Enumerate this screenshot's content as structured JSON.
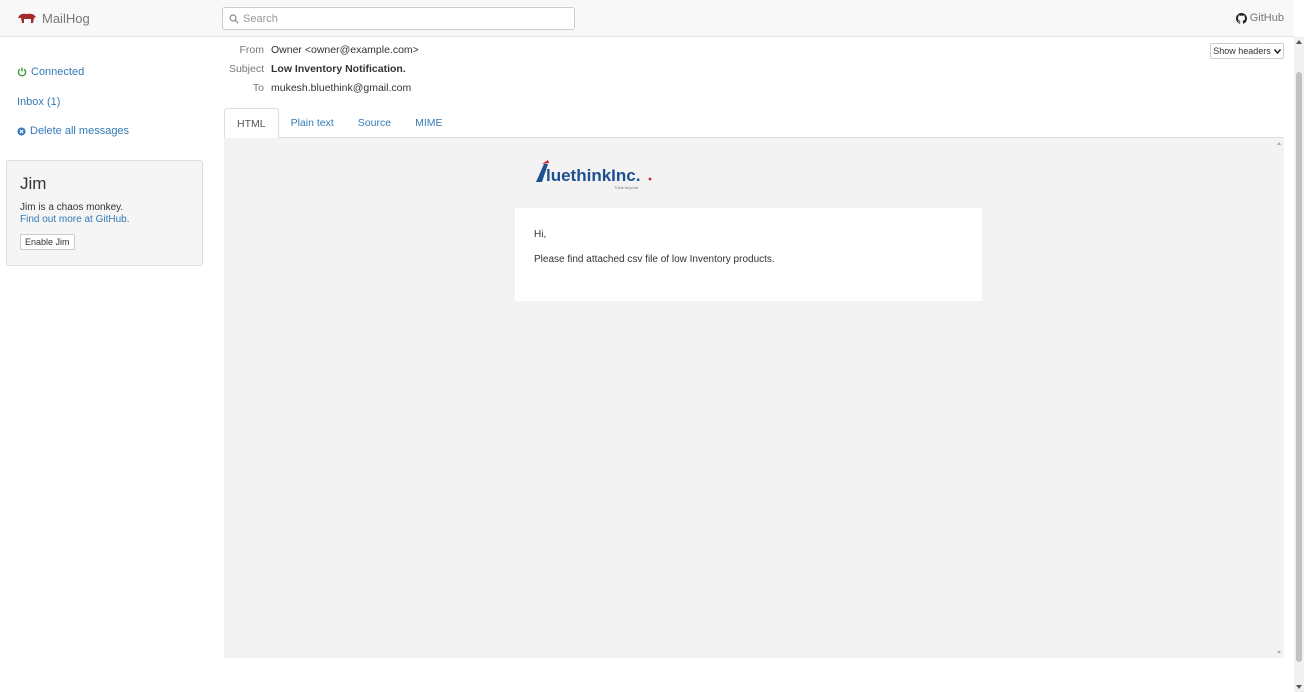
{
  "app": {
    "name": "MailHog",
    "github_label": "GitHub"
  },
  "search": {
    "placeholder": "Search"
  },
  "sidebar": {
    "connected": "Connected",
    "inbox": "Inbox (1)",
    "delete_all": "Delete all messages",
    "jim": {
      "title": "Jim",
      "description": "Jim is a chaos monkey.",
      "link": "Find out more at GitHub.",
      "button": "Enable Jim"
    }
  },
  "message": {
    "from_label": "From",
    "from": "Owner <owner@example.com>",
    "subject_label": "Subject",
    "subject": "Low Inventory Notification.",
    "to_label": "To",
    "to": "mukesh.bluethink@gmail.com",
    "show_headers": "Show headers",
    "tabs": [
      {
        "label": "HTML",
        "active": true
      },
      {
        "label": "Plain text",
        "active": false
      },
      {
        "label": "Source",
        "active": false
      },
      {
        "label": "MIME",
        "active": false
      }
    ],
    "body": {
      "logo": {
        "text": "luethinkInc.",
        "tagline": "Think beyond"
      },
      "greeting": "Hi,",
      "text": "Please find attached csv file of low Inventory products."
    }
  },
  "colors": {
    "link": "#337ab7",
    "connected": "#3c9a3c",
    "logo_blue": "#1d4f91",
    "logo_red": "#c8202f",
    "brand_icon": "#a52a2a"
  },
  "icons": {
    "brand": "hog-icon",
    "search": "search-icon",
    "github": "github-icon",
    "connected": "power-icon",
    "delete": "delete-circle-icon",
    "show_headers": "chevron-down-icon"
  }
}
